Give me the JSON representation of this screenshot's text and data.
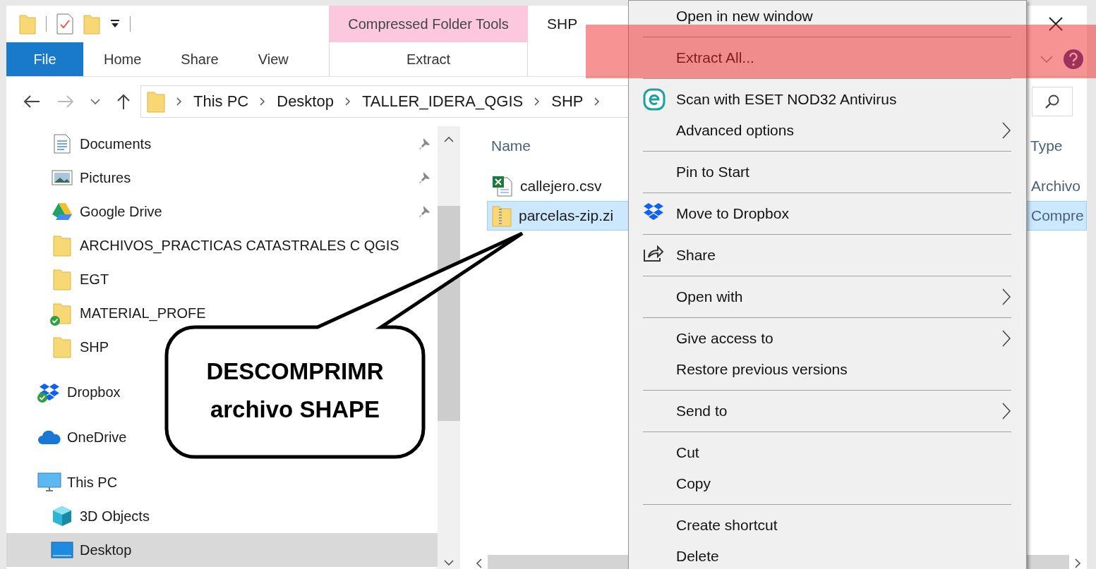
{
  "title_bar": {
    "contextual_group": "Compressed Folder Tools",
    "title": "SHP"
  },
  "ribbon_tabs": [
    {
      "label": "File",
      "kind": "file"
    },
    {
      "label": "Home",
      "kind": "standard"
    },
    {
      "label": "Share",
      "kind": "standard"
    },
    {
      "label": "View",
      "kind": "standard"
    },
    {
      "label": "Extract",
      "kind": "contextual"
    }
  ],
  "address_bar": {
    "crumbs": [
      "This PC",
      "Desktop",
      "TALLER_IDERA_QGIS",
      "SHP"
    ]
  },
  "navigation_pane": {
    "quick_access_items": [
      {
        "label": "Documents",
        "pinned": true,
        "synced": false,
        "selected": false
      },
      {
        "label": "Pictures",
        "pinned": true,
        "synced": false,
        "selected": false
      },
      {
        "label": "Google Drive",
        "pinned": true,
        "synced": false,
        "selected": false
      },
      {
        "label": "ARCHIVOS_PRACTICAS CATASTRALES C QGIS",
        "pinned": false,
        "synced": false,
        "selected": false
      },
      {
        "label": "EGT",
        "pinned": false,
        "synced": false,
        "selected": false
      },
      {
        "label": "MATERIAL_PROFE",
        "pinned": false,
        "synced": true,
        "selected": false
      },
      {
        "label": "SHP",
        "pinned": false,
        "synced": false,
        "selected": false
      }
    ],
    "items": [
      {
        "label": "Dropbox",
        "synced": true,
        "selected": false
      },
      {
        "label": "OneDrive",
        "synced": false,
        "selected": false
      },
      {
        "label": "This PC",
        "synced": false,
        "selected": false,
        "children": [
          {
            "label": "3D Objects",
            "synced": false,
            "selected": false
          },
          {
            "label": "Desktop",
            "synced": false,
            "selected": true
          }
        ]
      }
    ]
  },
  "file_list": {
    "columns": [
      "Name",
      "Type"
    ],
    "rows": [
      {
        "name": "callejero.csv",
        "type": "Archivo",
        "selected": false
      },
      {
        "name": "parcelas-zip.zi",
        "type": "Compre",
        "selected": true
      }
    ]
  },
  "context_menu": {
    "groups": [
      {
        "items": [
          {
            "label": "Open in new window",
            "submenu": false
          }
        ]
      },
      {
        "items": [
          {
            "label": "Extract All...",
            "submenu": false
          }
        ]
      },
      {
        "items": [
          {
            "label": "Scan with ESET NOD32 Antivirus",
            "submenu": false
          },
          {
            "label": "Advanced options",
            "submenu": true
          }
        ]
      },
      {
        "items": [
          {
            "label": "Pin to Start",
            "submenu": false
          }
        ]
      },
      {
        "items": [
          {
            "label": "Move to Dropbox",
            "submenu": false
          }
        ]
      },
      {
        "items": [
          {
            "label": "Share",
            "submenu": false
          }
        ]
      },
      {
        "items": [
          {
            "label": "Open with",
            "submenu": true
          }
        ]
      },
      {
        "items": [
          {
            "label": "Give access to",
            "submenu": true
          },
          {
            "label": "Restore previous versions",
            "submenu": false
          }
        ]
      },
      {
        "items": [
          {
            "label": "Send to",
            "submenu": true
          }
        ]
      },
      {
        "items": [
          {
            "label": "Cut",
            "submenu": false
          },
          {
            "label": "Copy",
            "submenu": false
          }
        ]
      },
      {
        "items": [
          {
            "label": "Create shortcut",
            "submenu": false
          },
          {
            "label": "Delete",
            "submenu": false
          }
        ]
      }
    ]
  },
  "callout": {
    "text": "DESCOMPRIMR archivo SHAPE"
  }
}
